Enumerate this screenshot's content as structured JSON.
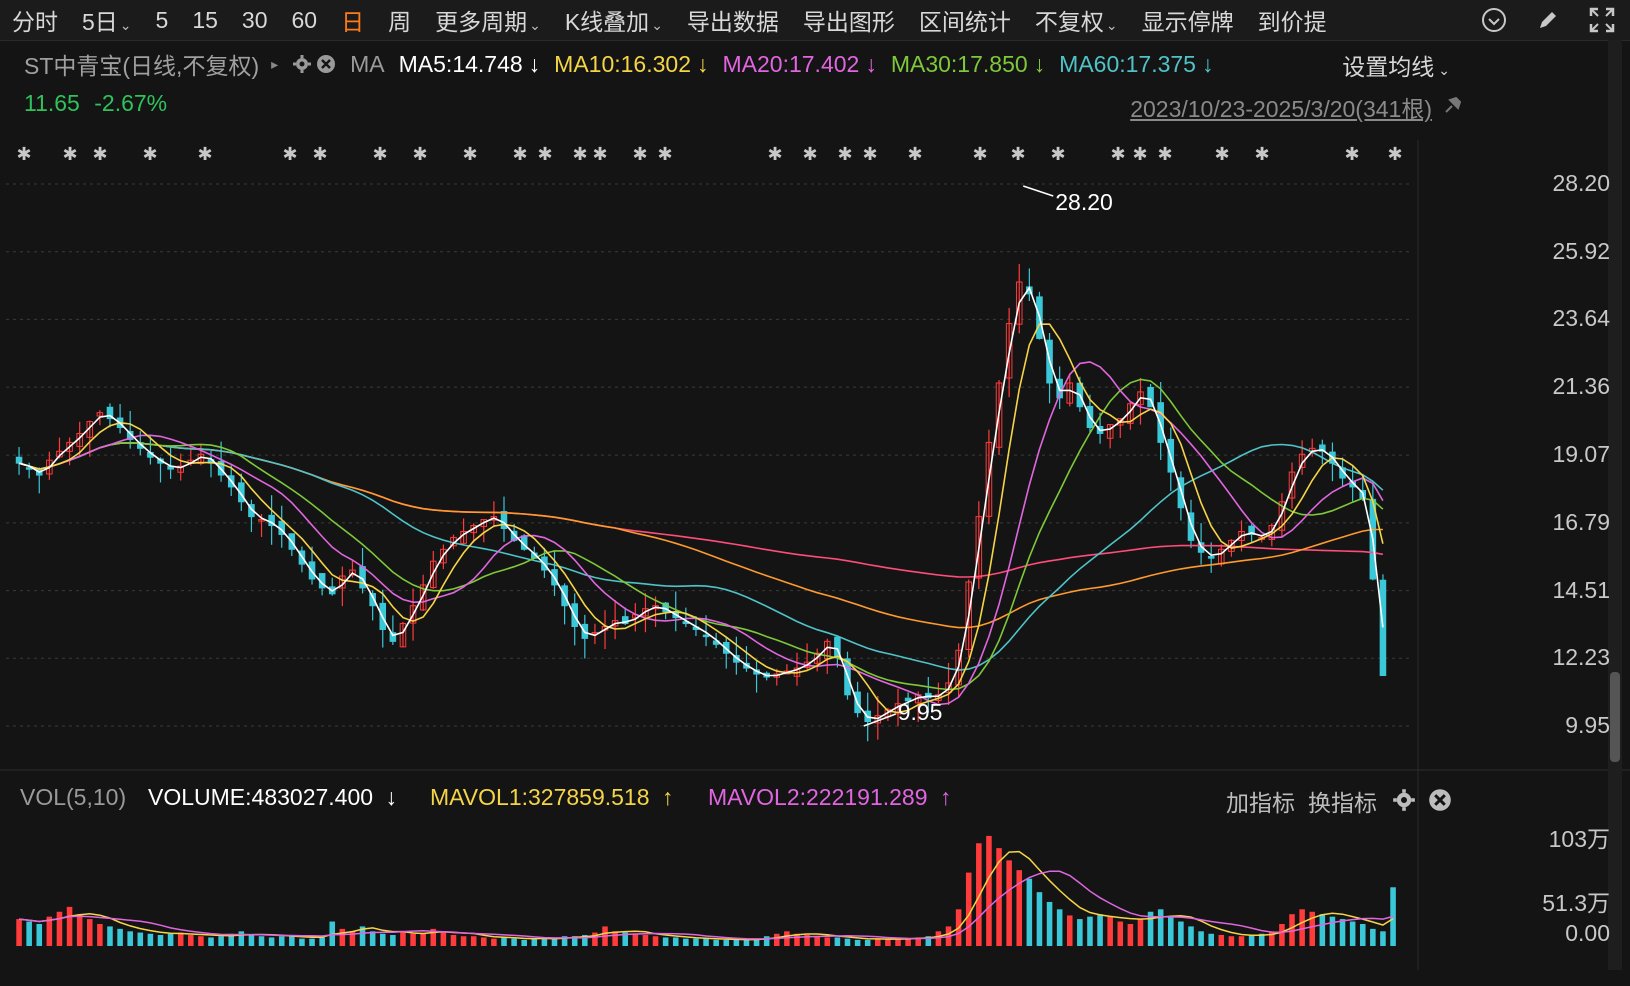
{
  "toolbar": {
    "periods": [
      {
        "label": "分时"
      },
      {
        "label": "5日",
        "caret": true
      },
      {
        "label": "5"
      },
      {
        "label": "15"
      },
      {
        "label": "30"
      },
      {
        "label": "60"
      },
      {
        "label": "日",
        "active": true
      },
      {
        "label": "周"
      },
      {
        "label": "更多周期",
        "caret": true
      },
      {
        "label": "K线叠加",
        "caret": true
      },
      {
        "label": "导出数据"
      },
      {
        "label": "导出图形"
      },
      {
        "label": "区间统计"
      },
      {
        "label": "不复权",
        "caret": true
      },
      {
        "label": "显示停牌"
      },
      {
        "label": "到价提"
      }
    ]
  },
  "header": {
    "stock_name": "ST中青宝(日线,不复权)",
    "ma_label": "MA",
    "ma_items": [
      {
        "label": "MA5:14.748",
        "color": "#ffffff",
        "arrow": "↓"
      },
      {
        "label": "MA10:16.302",
        "color": "#f5d547",
        "arrow": "↓"
      },
      {
        "label": "MA20:17.402",
        "color": "#e066e0",
        "arrow": "↓"
      },
      {
        "label": "MA30:17.850",
        "color": "#7ec83a",
        "arrow": "↓"
      },
      {
        "label": "MA60:17.375",
        "color": "#4fc3c8",
        "arrow": "↓"
      }
    ],
    "set_ma": "设置均线",
    "last_price": "11.65",
    "change_pct": "-2.67%",
    "range": "2023/10/23-2025/3/20(341根)"
  },
  "chart_data": {
    "type": "candlestick",
    "price_axis_ticks": [
      "28.20",
      "25.92",
      "23.64",
      "21.36",
      "19.07",
      "16.79",
      "14.51",
      "12.23",
      "9.95"
    ],
    "ylim": [
      9.95,
      28.2
    ],
    "high_marker": "28.20",
    "low_marker": "9.95",
    "ma_colors": {
      "ma5": "#ffffff",
      "ma10": "#f5d547",
      "ma20": "#e066e0",
      "ma30": "#7ec83a",
      "ma60": "#4fc3c8",
      "ma120": "#ff9a2e",
      "ma250": "#ff4d7a"
    },
    "close_series": [
      18.8,
      18.6,
      18.4,
      18.9,
      19.2,
      19.5,
      19.8,
      20.2,
      20.5,
      20.3,
      20.0,
      19.6,
      19.3,
      19.0,
      18.8,
      18.6,
      18.7,
      18.9,
      19.1,
      18.8,
      18.4,
      18.0,
      17.5,
      17.0,
      16.9,
      16.7,
      16.4,
      15.9,
      15.4,
      14.9,
      14.6,
      14.4,
      15.0,
      15.2,
      14.6,
      14.0,
      13.2,
      12.8,
      13.4,
      14.0,
      14.7,
      15.5,
      15.9,
      16.3,
      16.5,
      16.7,
      16.9,
      17.0,
      16.6,
      16.2,
      15.9,
      15.6,
      15.2,
      14.7,
      14.0,
      13.3,
      12.9,
      13.1,
      13.3,
      13.5,
      13.4,
      13.7,
      13.9,
      14.0,
      13.8,
      13.6,
      13.4,
      13.2,
      13.0,
      12.7,
      12.4,
      12.1,
      11.9,
      11.7,
      11.6,
      11.7,
      11.8,
      11.9,
      12.1,
      12.4,
      12.8,
      12.3,
      11.0,
      10.4,
      10.1,
      10.3,
      10.5,
      10.7,
      10.8,
      11.0,
      10.9,
      11.0,
      11.4,
      12.5,
      14.8,
      17.0,
      19.5,
      21.5,
      23.5,
      24.9,
      24.5,
      23.0,
      21.5,
      21.0,
      21.5,
      20.7,
      20.0,
      19.8,
      20.1,
      20.3,
      20.8,
      21.2,
      20.7,
      19.5,
      18.5,
      17.3,
      16.2,
      15.8,
      15.6,
      15.9,
      16.2,
      16.5,
      16.4,
      16.3,
      16.7,
      17.5,
      18.5,
      19.1,
      19.3,
      19.2,
      18.8,
      18.3,
      18.0,
      17.6,
      14.9,
      11.65
    ],
    "vol_axis_ticks": [
      "103万",
      "51.3万",
      "0.00"
    ],
    "vol_max": 103,
    "volume": [
      22,
      20,
      18,
      24,
      28,
      32,
      26,
      22,
      18,
      16,
      14,
      12,
      11,
      10,
      9,
      10,
      11,
      9,
      8,
      7,
      8,
      10,
      12,
      9,
      8,
      7,
      8,
      9,
      6,
      6,
      7,
      20,
      14,
      12,
      16,
      12,
      10,
      9,
      12,
      10,
      10,
      14,
      12,
      9,
      8,
      8,
      7,
      6,
      7,
      6,
      5,
      6,
      7,
      6,
      8,
      8,
      9,
      11,
      16,
      12,
      11,
      10,
      9,
      8,
      7,
      7,
      6,
      6,
      6,
      5,
      5,
      5,
      5,
      6,
      8,
      10,
      12,
      10,
      9,
      8,
      7,
      7,
      6,
      5,
      5,
      6,
      6,
      6,
      6,
      7,
      8,
      12,
      16,
      30,
      60,
      84,
      90,
      80,
      70,
      62,
      55,
      44,
      36,
      30,
      25,
      22,
      24,
      26,
      24,
      20,
      18,
      22,
      28,
      30,
      24,
      20,
      16,
      12,
      10,
      9,
      8,
      8,
      9,
      10,
      12,
      18,
      26,
      30,
      28,
      26,
      24,
      22,
      20,
      18,
      14,
      12,
      48
    ]
  },
  "volume": {
    "title": "VOL(5,10)",
    "volume_label": "VOLUME:483027.400",
    "volume_arrow": "↓",
    "mavol1_label": "MAVOL1:327859.518",
    "mavol1_arrow": "↑",
    "mavol2_label": "MAVOL2:222191.289",
    "mavol2_arrow": "↑",
    "add_indicator": "加指标",
    "switch_indicator": "换指标"
  },
  "icons": {
    "settings": "gear-icon",
    "close": "close-icon",
    "clock": "clock-icon",
    "pen": "pen-icon",
    "fullscreen": "fullscreen-icon"
  }
}
